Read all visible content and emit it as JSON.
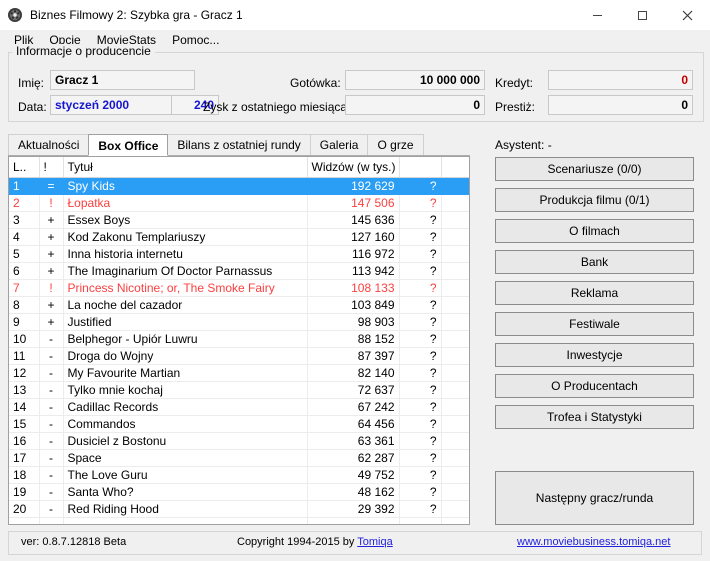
{
  "window": {
    "title": "Biznes Filmowy 2: Szybka gra - Gracz 1",
    "icon": "film-reel-icon",
    "controls": {
      "minimize": "minimize-icon",
      "maximize": "maximize-icon",
      "close": "close-icon"
    }
  },
  "menu": {
    "items": [
      {
        "label": "Plik"
      },
      {
        "label": "Opcje"
      },
      {
        "label": "MovieStats"
      },
      {
        "label": "Pomoc..."
      }
    ]
  },
  "producer": {
    "legend": "Informacje o producencie",
    "name_label": "Imię:",
    "name_value": "Gracz 1",
    "date_label": "Data:",
    "date_value": "styczeń 2000",
    "turn_value": "240",
    "cash_label": "Gotówka:",
    "cash_value": "10 000 000",
    "profit_label": "Zysk z ostatniego miesiąca:",
    "profit_value": "0",
    "credit_label": "Kredyt:",
    "credit_value": "0",
    "prestige_label": "Prestiż:",
    "prestige_value": "0",
    "colors": {
      "blue": "#1616d0",
      "red": "#c00000"
    }
  },
  "tabs": [
    {
      "label": "Aktualności",
      "selected": false
    },
    {
      "label": "Box Office",
      "selected": true
    },
    {
      "label": "Bilans z ostatniej rundy",
      "selected": false
    },
    {
      "label": "Galeria",
      "selected": false
    },
    {
      "label": "O grze",
      "selected": false
    }
  ],
  "table": {
    "headers": [
      "L..",
      "!",
      "Tytuł",
      "Widzów (w tys.)",
      "",
      ""
    ],
    "selection_color": "#2a9df4",
    "red_color": "#fc4040",
    "rows": [
      {
        "rank": "1",
        "flag": "=",
        "title": "Spy Kids",
        "views": "192 629",
        "extra": "?",
        "style": "selected"
      },
      {
        "rank": "2",
        "flag": "!",
        "title": "Łopatka",
        "views": "147 506",
        "extra": "?",
        "style": "red"
      },
      {
        "rank": "3",
        "flag": "+",
        "title": "Essex Boys",
        "views": "145 636",
        "extra": "?",
        "style": "normal"
      },
      {
        "rank": "4",
        "flag": "+",
        "title": "Kod Zakonu Templariuszy",
        "views": "127 160",
        "extra": "?",
        "style": "normal"
      },
      {
        "rank": "5",
        "flag": "+",
        "title": "Inna historia internetu",
        "views": "116 972",
        "extra": "?",
        "style": "normal"
      },
      {
        "rank": "6",
        "flag": "+",
        "title": "The Imaginarium Of Doctor Parnassus",
        "views": "113 942",
        "extra": "?",
        "style": "normal"
      },
      {
        "rank": "7",
        "flag": "!",
        "title": "Princess Nicotine; or, The Smoke Fairy",
        "views": "108 133",
        "extra": "?",
        "style": "red"
      },
      {
        "rank": "8",
        "flag": "+",
        "title": "La noche del cazador",
        "views": "103 849",
        "extra": "?",
        "style": "normal"
      },
      {
        "rank": "9",
        "flag": "+",
        "title": "Justified",
        "views": "98 903",
        "extra": "?",
        "style": "normal"
      },
      {
        "rank": "10",
        "flag": "-",
        "title": "Belphegor - Upiór Luwru",
        "views": "88 152",
        "extra": "?",
        "style": "normal"
      },
      {
        "rank": "11",
        "flag": "-",
        "title": "Droga do Wojny",
        "views": "87 397",
        "extra": "?",
        "style": "normal"
      },
      {
        "rank": "12",
        "flag": "-",
        "title": "My Favourite Martian",
        "views": "82 140",
        "extra": "?",
        "style": "normal"
      },
      {
        "rank": "13",
        "flag": "-",
        "title": "Tylko mnie kochaj",
        "views": "72 637",
        "extra": "?",
        "style": "normal"
      },
      {
        "rank": "14",
        "flag": "-",
        "title": "Cadillac Records",
        "views": "67 242",
        "extra": "?",
        "style": "normal"
      },
      {
        "rank": "15",
        "flag": "-",
        "title": "Commandos",
        "views": "64 456",
        "extra": "?",
        "style": "normal"
      },
      {
        "rank": "16",
        "flag": "-",
        "title": "Dusiciel z Bostonu",
        "views": "63 361",
        "extra": "?",
        "style": "normal"
      },
      {
        "rank": "17",
        "flag": "-",
        "title": "Space",
        "views": "62 287",
        "extra": "?",
        "style": "normal"
      },
      {
        "rank": "18",
        "flag": "-",
        "title": "The Love Guru",
        "views": "49 752",
        "extra": "?",
        "style": "normal"
      },
      {
        "rank": "19",
        "flag": "-",
        "title": "Santa Who?",
        "views": "48 162",
        "extra": "?",
        "style": "normal"
      },
      {
        "rank": "20",
        "flag": "-",
        "title": "Red Riding Hood",
        "views": "29 392",
        "extra": "?",
        "style": "normal"
      },
      {
        "rank": "",
        "flag": "",
        "title": "",
        "views": "",
        "extra": "",
        "style": "empty"
      }
    ]
  },
  "sidebar": {
    "assistant_label": "Asystent: -",
    "buttons": [
      {
        "label": "Scenariusze (0/0)"
      },
      {
        "label": "Produkcja filmu (0/1)"
      },
      {
        "label": "O filmach"
      },
      {
        "label": "Bank"
      },
      {
        "label": "Reklama"
      },
      {
        "label": "Festiwale"
      },
      {
        "label": "Inwestycje"
      },
      {
        "label": "O Producentach"
      },
      {
        "label": "Trofea i Statystyki"
      }
    ],
    "next_button": "Następny gracz/runda"
  },
  "statusbar": {
    "version": "ver: 0.8.7.12818 Beta",
    "copyright": "Copyright 1994-2015 by",
    "author_link": "Tomiqa",
    "site_link": "www.moviebusiness.tomiqa.net",
    "link_color": "#2222dd"
  }
}
